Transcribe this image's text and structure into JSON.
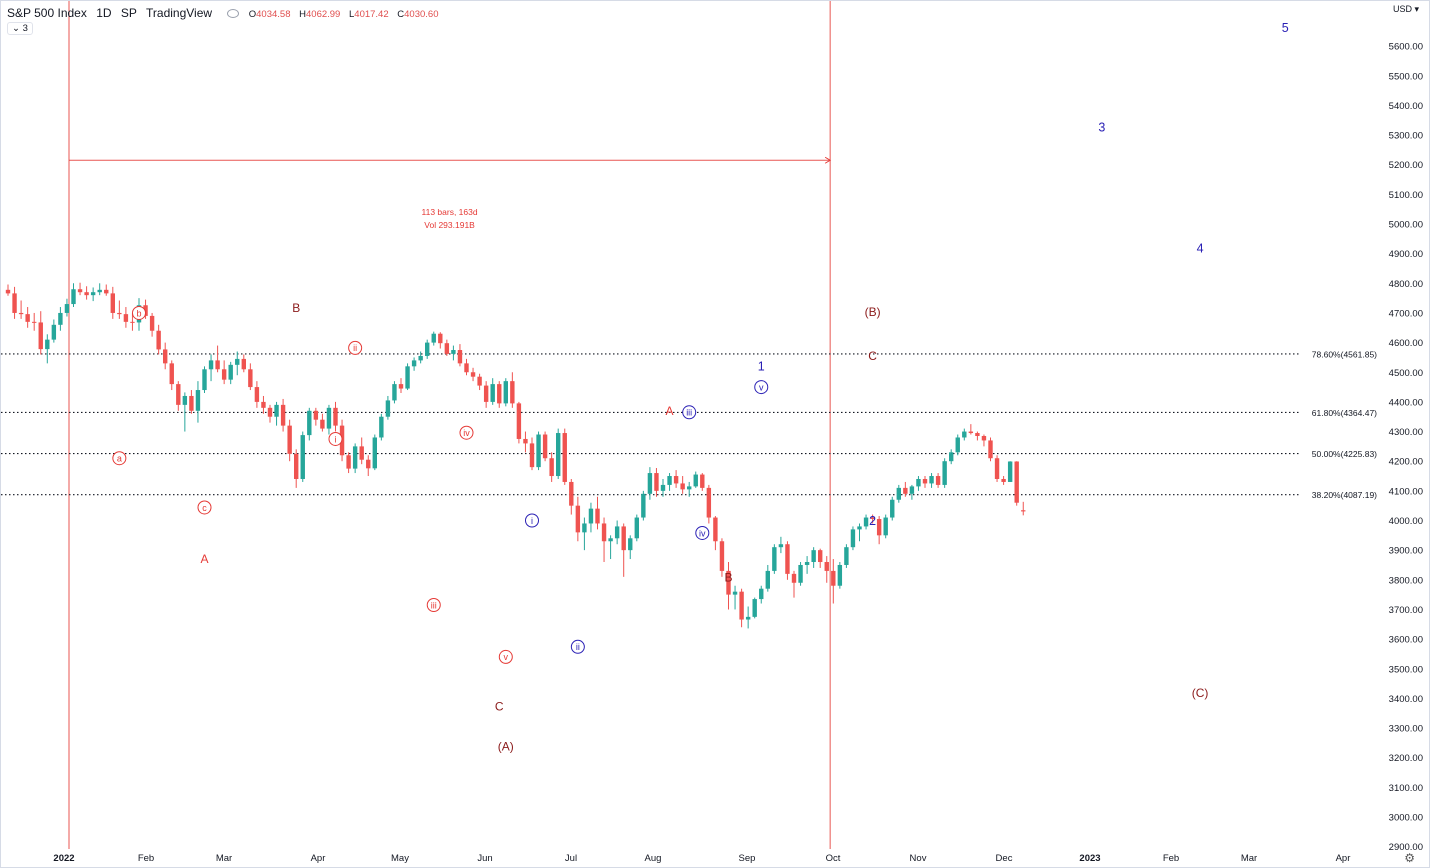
{
  "header": {
    "symbol": "S&P 500 Index",
    "interval": "1D",
    "exchange": "SP",
    "source": "TradingView",
    "ohlc": {
      "o": "4034.58",
      "h": "4062.99",
      "l": "4017.42",
      "c": "4030.60"
    },
    "o_prefix": "O",
    "h_prefix": "H",
    "l_prefix": "L",
    "c_prefix": "C",
    "collapse_count": "3"
  },
  "currency_button": "USD",
  "colors": {
    "up": "#26a69a",
    "down": "#ef5350",
    "red_annot": "#e53935",
    "blue_wave": "#2a20b5",
    "dark_red": "#8b1a1a"
  },
  "chart_data": {
    "type": "candlestick",
    "xlabel": "",
    "ylabel": "",
    "ylim": [
      2900,
      5700
    ],
    "x_ticks": [
      "2022",
      "Feb",
      "Mar",
      "Apr",
      "May",
      "Jun",
      "Jul",
      "Aug",
      "Sep",
      "Oct",
      "Nov",
      "Dec",
      "2023",
      "Feb",
      "Mar",
      "Apr"
    ],
    "y_ticks": [
      "2900.00",
      "3000.00",
      "3100.00",
      "3200.00",
      "3300.00",
      "3400.00",
      "3500.00",
      "3600.00",
      "3700.00",
      "3800.00",
      "3900.00",
      "4000.00",
      "4100.00",
      "4200.00",
      "4300.00",
      "4400.00",
      "4500.00",
      "4600.00",
      "4700.00",
      "4800.00",
      "4900.00",
      "5000.00",
      "5100.00",
      "5200.00",
      "5300.00",
      "5400.00",
      "5500.00",
      "5600.00"
    ],
    "fib_levels": [
      {
        "label": "78.60%(4561.85)",
        "value": 4561.85
      },
      {
        "label": "61.80%(4364.47)",
        "value": 4364.47
      },
      {
        "label": "50.00%(4225.83)",
        "value": 4225.83
      },
      {
        "label": "38.20%(4087.19)",
        "value": 4087.19
      }
    ],
    "date_range": {
      "start_index": 0,
      "end_index": 113,
      "line_value": 5215,
      "label_line1": "113 bars, 163d",
      "label_line2": "Vol 293.191B"
    },
    "candles": [
      [
        4778,
        4796,
        4758,
        4766
      ],
      [
        4766,
        4788,
        4680,
        4700
      ],
      [
        4700,
        4742,
        4680,
        4696
      ],
      [
        4696,
        4720,
        4650,
        4670
      ],
      [
        4670,
        4700,
        4640,
        4668
      ],
      [
        4668,
        4706,
        4560,
        4578
      ],
      [
        4578,
        4628,
        4530,
        4610
      ],
      [
        4610,
        4678,
        4600,
        4660
      ],
      [
        4660,
        4720,
        4640,
        4700
      ],
      [
        4700,
        4748,
        4688,
        4730
      ],
      [
        4730,
        4800,
        4720,
        4780
      ],
      [
        4780,
        4802,
        4760,
        4770
      ],
      [
        4770,
        4790,
        4745,
        4760
      ],
      [
        4760,
        4786,
        4740,
        4770
      ],
      [
        4770,
        4800,
        4760,
        4778
      ],
      [
        4778,
        4796,
        4758,
        4766
      ],
      [
        4766,
        4788,
        4680,
        4700
      ],
      [
        4700,
        4742,
        4680,
        4696
      ],
      [
        4696,
        4720,
        4650,
        4670
      ],
      [
        4670,
        4700,
        4640,
        4668
      ],
      [
        4668,
        4750,
        4640,
        4726
      ],
      [
        4726,
        4745,
        4680,
        4690
      ],
      [
        4690,
        4700,
        4620,
        4640
      ],
      [
        4640,
        4660,
        4560,
        4577
      ],
      [
        4577,
        4600,
        4510,
        4530
      ],
      [
        4530,
        4540,
        4440,
        4460
      ],
      [
        4460,
        4470,
        4370,
        4390
      ],
      [
        4390,
        4432,
        4300,
        4420
      ],
      [
        4420,
        4440,
        4360,
        4370
      ],
      [
        4370,
        4470,
        4330,
        4440
      ],
      [
        4440,
        4520,
        4430,
        4510
      ],
      [
        4510,
        4560,
        4470,
        4540
      ],
      [
        4540,
        4590,
        4500,
        4510
      ],
      [
        4510,
        4540,
        4460,
        4475
      ],
      [
        4475,
        4535,
        4460,
        4525
      ],
      [
        4525,
        4570,
        4490,
        4545
      ],
      [
        4545,
        4560,
        4500,
        4510
      ],
      [
        4510,
        4530,
        4440,
        4450
      ],
      [
        4450,
        4470,
        4380,
        4400
      ],
      [
        4400,
        4420,
        4360,
        4380
      ],
      [
        4380,
        4390,
        4330,
        4350
      ],
      [
        4350,
        4400,
        4320,
        4390
      ],
      [
        4390,
        4410,
        4300,
        4320
      ],
      [
        4320,
        4340,
        4200,
        4225
      ],
      [
        4225,
        4240,
        4110,
        4140
      ],
      [
        4140,
        4300,
        4130,
        4288
      ],
      [
        4288,
        4380,
        4270,
        4370
      ],
      [
        4370,
        4380,
        4320,
        4340
      ],
      [
        4340,
        4360,
        4300,
        4310
      ],
      [
        4310,
        4390,
        4290,
        4380
      ],
      [
        4380,
        4400,
        4300,
        4320
      ],
      [
        4320,
        4340,
        4200,
        4220
      ],
      [
        4220,
        4230,
        4160,
        4175
      ],
      [
        4175,
        4260,
        4160,
        4250
      ],
      [
        4250,
        4280,
        4190,
        4205
      ],
      [
        4205,
        4220,
        4150,
        4176
      ],
      [
        4176,
        4290,
        4170,
        4280
      ],
      [
        4280,
        4360,
        4270,
        4350
      ],
      [
        4350,
        4420,
        4340,
        4405
      ],
      [
        4405,
        4470,
        4395,
        4460
      ],
      [
        4460,
        4480,
        4430,
        4445
      ],
      [
        4445,
        4530,
        4440,
        4520
      ],
      [
        4520,
        4550,
        4505,
        4540
      ],
      [
        4540,
        4570,
        4530,
        4555
      ],
      [
        4555,
        4610,
        4545,
        4600
      ],
      [
        4600,
        4637,
        4590,
        4630
      ],
      [
        4630,
        4635,
        4580,
        4598
      ],
      [
        4598,
        4610,
        4555,
        4562
      ],
      [
        4562,
        4590,
        4540,
        4575
      ],
      [
        4575,
        4595,
        4520,
        4530
      ],
      [
        4530,
        4545,
        4490,
        4500
      ],
      [
        4500,
        4515,
        4470,
        4485
      ],
      [
        4485,
        4495,
        4440,
        4455
      ],
      [
        4455,
        4470,
        4380,
        4400
      ],
      [
        4400,
        4480,
        4390,
        4460
      ],
      [
        4460,
        4470,
        4380,
        4395
      ],
      [
        4395,
        4480,
        4385,
        4470
      ],
      [
        4470,
        4500,
        4380,
        4395
      ],
      [
        4395,
        4400,
        4260,
        4275
      ],
      [
        4275,
        4300,
        4230,
        4260
      ],
      [
        4260,
        4280,
        4170,
        4180
      ],
      [
        4180,
        4300,
        4170,
        4290
      ],
      [
        4290,
        4300,
        4200,
        4210
      ],
      [
        4210,
        4230,
        4130,
        4150
      ],
      [
        4150,
        4310,
        4140,
        4295
      ],
      [
        4295,
        4310,
        4120,
        4130
      ],
      [
        4130,
        4140,
        4020,
        4050
      ],
      [
        4050,
        4080,
        3930,
        3960
      ],
      [
        3960,
        4010,
        3900,
        3990
      ],
      [
        3990,
        4060,
        3960,
        4040
      ],
      [
        4040,
        4080,
        3970,
        3990
      ],
      [
        3990,
        4010,
        3860,
        3930
      ],
      [
        3930,
        3950,
        3870,
        3940
      ],
      [
        3940,
        4000,
        3920,
        3980
      ],
      [
        3980,
        3990,
        3810,
        3900
      ],
      [
        3900,
        3950,
        3870,
        3940
      ],
      [
        3940,
        4020,
        3930,
        4010
      ],
      [
        4010,
        4100,
        4000,
        4090
      ],
      [
        4090,
        4180,
        4070,
        4160
      ],
      [
        4160,
        4177,
        4080,
        4100
      ],
      [
        4100,
        4140,
        4080,
        4120
      ],
      [
        4120,
        4160,
        4100,
        4150
      ],
      [
        4150,
        4170,
        4110,
        4125
      ],
      [
        4125,
        4150,
        4090,
        4105
      ],
      [
        4105,
        4130,
        4080,
        4115
      ],
      [
        4115,
        4165,
        4110,
        4155
      ],
      [
        4155,
        4160,
        4100,
        4110
      ],
      [
        4110,
        4120,
        3990,
        4010
      ],
      [
        4010,
        4015,
        3900,
        3930
      ],
      [
        3930,
        3940,
        3810,
        3830
      ],
      [
        3830,
        3860,
        3700,
        3750
      ],
      [
        3750,
        3780,
        3700,
        3760
      ],
      [
        3760,
        3770,
        3640,
        3666
      ],
      [
        3666,
        3710,
        3636,
        3675
      ],
      [
        3675,
        3740,
        3670,
        3735
      ],
      [
        3735,
        3780,
        3720,
        3770
      ],
      [
        3770,
        3850,
        3760,
        3830
      ],
      [
        3830,
        3920,
        3820,
        3910
      ],
      [
        3910,
        3945,
        3890,
        3920
      ],
      [
        3920,
        3930,
        3800,
        3820
      ],
      [
        3820,
        3830,
        3740,
        3790
      ],
      [
        3790,
        3860,
        3780,
        3850
      ],
      [
        3850,
        3880,
        3820,
        3860
      ],
      [
        3860,
        3910,
        3840,
        3900
      ],
      [
        3900,
        3905,
        3840,
        3860
      ],
      [
        3860,
        3880,
        3790,
        3830
      ],
      [
        3830,
        3870,
        3720,
        3780
      ],
      [
        3780,
        3860,
        3770,
        3850
      ],
      [
        3850,
        3920,
        3840,
        3910
      ],
      [
        3910,
        3980,
        3900,
        3970
      ],
      [
        3970,
        3990,
        3930,
        3980
      ],
      [
        3980,
        4020,
        3970,
        4010
      ],
      [
        4010,
        4020,
        3990,
        4005
      ],
      [
        4005,
        4015,
        3920,
        3950
      ],
      [
        3950,
        4020,
        3940,
        4010
      ],
      [
        4010,
        4080,
        4000,
        4070
      ],
      [
        4070,
        4120,
        4060,
        4110
      ],
      [
        4110,
        4130,
        4080,
        4090
      ],
      [
        4090,
        4120,
        4070,
        4115
      ],
      [
        4115,
        4150,
        4100,
        4140
      ],
      [
        4140,
        4150,
        4110,
        4125
      ],
      [
        4125,
        4160,
        4110,
        4150
      ],
      [
        4150,
        4160,
        4110,
        4120
      ],
      [
        4120,
        4210,
        4110,
        4200
      ],
      [
        4200,
        4240,
        4190,
        4230
      ],
      [
        4230,
        4290,
        4220,
        4280
      ],
      [
        4280,
        4310,
        4270,
        4300
      ],
      [
        4300,
        4325,
        4290,
        4295
      ],
      [
        4295,
        4300,
        4270,
        4285
      ],
      [
        4285,
        4290,
        4250,
        4270
      ],
      [
        4270,
        4280,
        4200,
        4210
      ],
      [
        4210,
        4220,
        4130,
        4140
      ],
      [
        4140,
        4150,
        4120,
        4130
      ],
      [
        4130,
        4200,
        4130,
        4199
      ],
      [
        4199,
        4200,
        4050,
        4060
      ],
      [
        4034.58,
        4062.99,
        4017.42,
        4030.6
      ]
    ],
    "annotations": [
      {
        "text": "b",
        "style": "red_circle",
        "i": 20,
        "v": 4700
      },
      {
        "text": "a",
        "style": "red_circle",
        "i": 17,
        "v": 4210
      },
      {
        "text": "c",
        "style": "red_circle",
        "i": 30,
        "v": 4044
      },
      {
        "text": "A",
        "style": "red_letter",
        "i": 30,
        "v": 3870
      },
      {
        "text": "B",
        "style": "dark_letter",
        "i": 44,
        "v": 4717
      },
      {
        "text": "ii",
        "style": "red_circle",
        "i": 53,
        "v": 4582
      },
      {
        "text": "i",
        "style": "red_circle",
        "i": 50,
        "v": 4275
      },
      {
        "text": "iv",
        "style": "red_circle",
        "i": 70,
        "v": 4296
      },
      {
        "text": "iii",
        "style": "red_circle",
        "i": 65,
        "v": 3715
      },
      {
        "text": "v",
        "style": "red_circle",
        "i": 76,
        "v": 3540
      },
      {
        "text": "C",
        "style": "dark_letter",
        "i": 75,
        "v": 3372
      },
      {
        "text": "(A)",
        "style": "dark_letter",
        "i": 76,
        "v": 3237
      },
      {
        "text": "i",
        "style": "blue_circle",
        "i": 80,
        "v": 4000
      },
      {
        "text": "ii",
        "style": "blue_circle",
        "i": 87,
        "v": 3574
      },
      {
        "text": "A",
        "style": "red_letter",
        "i": 101,
        "v": 4370
      },
      {
        "text": "iii",
        "style": "blue_circle",
        "i": 104,
        "v": 4365
      },
      {
        "text": "iv",
        "style": "blue_circle",
        "i": 106,
        "v": 3958
      },
      {
        "text": "B",
        "style": "dark_letter",
        "i": 110,
        "v": 3807
      },
      {
        "text": "1",
        "style": "blue_number",
        "i": 115,
        "v": 4520
      },
      {
        "text": "v",
        "style": "blue_circle",
        "i": 115,
        "v": 4450
      },
      {
        "text": "(B)",
        "style": "dark_letter",
        "i": 132,
        "v": 4703
      },
      {
        "text": "C",
        "style": "dark_letter",
        "i": 132,
        "v": 4555
      },
      {
        "text": "2",
        "style": "blue_number",
        "i": 132,
        "v": 3999
      },
      {
        "text": "3",
        "style": "blue_number",
        "i": 167,
        "v": 5326
      },
      {
        "text": "4",
        "style": "blue_number",
        "i": 182,
        "v": 4917
      },
      {
        "text": "5",
        "style": "blue_number",
        "i": 195,
        "v": 5661
      },
      {
        "text": "(C)",
        "style": "dark_letter",
        "i": 182,
        "v": 3418
      }
    ]
  }
}
